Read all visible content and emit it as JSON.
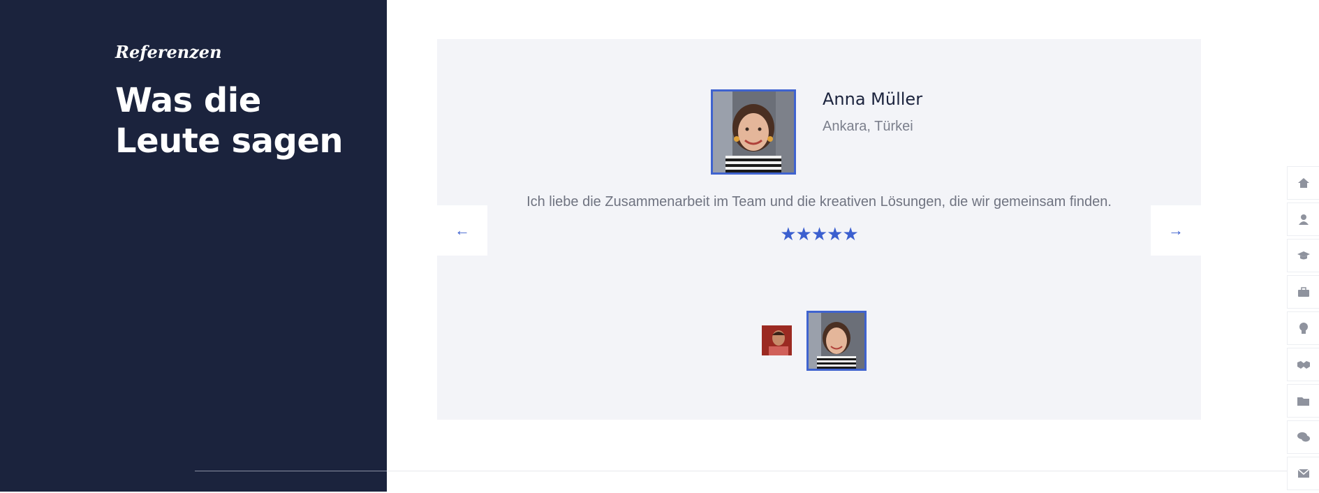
{
  "section": {
    "eyebrow": "Referenzen",
    "heading": "Was die Leute sagen"
  },
  "testimonial": {
    "name": "Anna Müller",
    "location": "Ankara, Türkei",
    "quote": "Ich liebe die Zusammenarbeit im Team und die kreativen Lösungen, die wir gemeinsam finden.",
    "rating": 5,
    "stars": "★★★★★"
  },
  "navigation": {
    "prev_icon": "arrow-left-icon",
    "next_icon": "arrow-right-icon",
    "prev_glyph": "←",
    "next_glyph": "→"
  },
  "side_nav": {
    "items": [
      "home-icon",
      "user-icon",
      "graduation-cap-icon",
      "briefcase-icon",
      "lightbulb-icon",
      "handshake-icon",
      "folder-icon",
      "chat-icon",
      "envelope-icon"
    ]
  },
  "colors": {
    "panel": "#1b233d",
    "card": "#f3f4f8",
    "accent": "#3b5fcf"
  }
}
